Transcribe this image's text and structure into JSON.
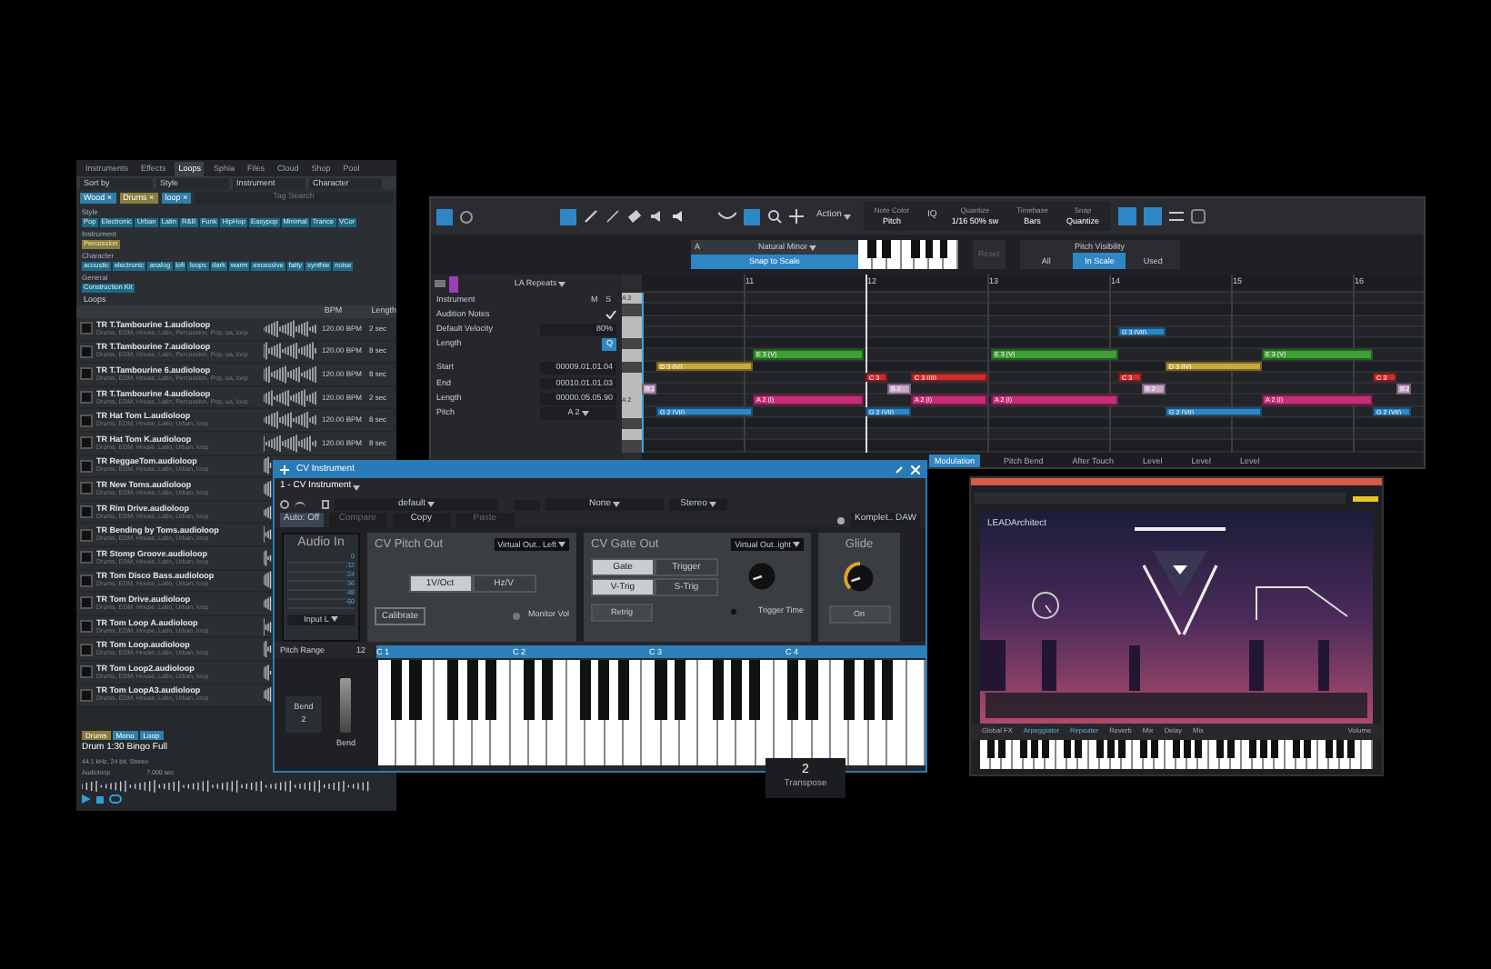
{
  "browser": {
    "tabs": [
      {
        "label": "Instruments",
        "selected": false
      },
      {
        "label": "Effects",
        "selected": false
      },
      {
        "label": "Loops",
        "selected": true
      },
      {
        "label": "Sphia",
        "selected": false
      },
      {
        "label": "Files",
        "selected": false
      },
      {
        "label": "Cloud",
        "selected": false
      },
      {
        "label": "Shop",
        "selected": false
      },
      {
        "label": "Pool",
        "selected": false
      }
    ],
    "filters": [
      "Sort by",
      "Style",
      "Instrument",
      "Character"
    ],
    "active_tags": [
      "Wood ×",
      "Drums ×",
      "loop ×"
    ],
    "search": {
      "placeholder": "Tag Search"
    },
    "tag_groups": [
      {
        "title": "Style",
        "tags": [
          {
            "label": "Pop",
            "selected": false
          },
          {
            "label": "Electronic",
            "selected": false
          },
          {
            "label": "Urban",
            "selected": false
          },
          {
            "label": "Latin",
            "selected": false
          },
          {
            "label": "R&B",
            "selected": false
          },
          {
            "label": "Funk",
            "selected": false
          },
          {
            "label": "HipHop",
            "selected": false
          },
          {
            "label": "Easypop",
            "selected": false
          },
          {
            "label": "Minimal",
            "selected": false
          },
          {
            "label": "Trance",
            "selected": false
          },
          {
            "label": "VCor",
            "selected": false
          }
        ]
      },
      {
        "title": "Instrument",
        "tags": [
          {
            "label": "Percussion",
            "selected": true
          }
        ]
      },
      {
        "title": "Character",
        "tags": [
          {
            "label": "acoustic",
            "selected": false
          },
          {
            "label": "electronic",
            "selected": false
          },
          {
            "label": "analog",
            "selected": false
          },
          {
            "label": "lofi",
            "selected": false
          },
          {
            "label": "loops",
            "selected": false
          },
          {
            "label": "dark",
            "selected": false
          },
          {
            "label": "warm",
            "selected": false
          },
          {
            "label": "excessive",
            "selected": false
          },
          {
            "label": "fatty",
            "selected": false
          },
          {
            "label": "synthie",
            "selected": false
          },
          {
            "label": "noise",
            "selected": false
          }
        ]
      },
      {
        "title": "General",
        "tags": [
          {
            "label": "Construction Kit",
            "selected": false
          }
        ]
      }
    ],
    "list_title": "Loops",
    "columns": [
      "BPM",
      "Length"
    ],
    "loops": [
      {
        "name": "TR T.Tambourine 1.audioloop",
        "tags": "Drums, EDM, House, Latin, Percussion, Pop, ua, loop",
        "bpm": "120.00 BPM",
        "length": "2 sec"
      },
      {
        "name": "TR T.Tambourine 7.audioloop",
        "tags": "Drums, EDM, House, Latin, Percussion, Pop, ua, loop",
        "bpm": "120.00 BPM",
        "length": "8 sec"
      },
      {
        "name": "TR T.Tambourine 6.audioloop",
        "tags": "Drums, EDM, House, Latin, Percussion, Pop, ua, loop",
        "bpm": "120.00 BPM",
        "length": "8 sec"
      },
      {
        "name": "TR T.Tambourine 4.audioloop",
        "tags": "Drums, EDM, House, Latin, Percussion, Pop, ua, loop",
        "bpm": "120.00 BPM",
        "length": "2 sec"
      },
      {
        "name": "TR Hat Tom L.audioloop",
        "tags": "Drums, EDM, House, Latin, Urban, loop",
        "bpm": "120.00 BPM",
        "length": "8 sec"
      },
      {
        "name": "TR Hat Tom K.audioloop",
        "tags": "Drums, EDM, House, Latin, Urban, loop",
        "bpm": "120.00 BPM",
        "length": "8 sec"
      },
      {
        "name": "TR ReggaeTom.audioloop",
        "tags": "Drums, EDM, House, Latin, Urban, loop"
      },
      {
        "name": "TR New Toms.audioloop",
        "tags": "Drums, EDM, House, Latin, Urban, loop"
      },
      {
        "name": "TR Rim Drive.audioloop",
        "tags": "Drums, EDM, House, Latin, Urban, loop"
      },
      {
        "name": "TR Bending by Toms.audioloop",
        "tags": "Drums, EDM, House, Latin, Urban, loop"
      },
      {
        "name": "TR Stomp Groove.audioloop",
        "tags": "Drums, EDM, House, Latin, Urban, loop"
      },
      {
        "name": "TR Tom Disco Bass.audioloop",
        "tags": "Drums, EDM, House, Latin, Urban, loop"
      },
      {
        "name": "TR Tom Drive.audioloop",
        "tags": "Drums, EDM, House, Latin, Urban, loop"
      },
      {
        "name": "TR Tom Loop A.audioloop",
        "tags": "Drums, EDM, House, Latin, Urban, loop"
      },
      {
        "name": "TR Tom Loop.audioloop",
        "tags": "Drums, EDM, House, Latin, Urban, loop"
      },
      {
        "name": "TR Tom Loop2.audioloop",
        "tags": "Drums, EDM, House, Latin, Urban, loop"
      },
      {
        "name": "TR Tom LoopA3.audioloop",
        "tags": "Drums, EDM, House, Latin, Urban, loop"
      }
    ],
    "preview": {
      "tags": [
        {
          "label": "Drums",
          "color": "#8a7d3c"
        },
        {
          "label": "Mono",
          "color": "#2f7fa8"
        },
        {
          "label": "Loop",
          "color": "#2f7fa8"
        }
      ],
      "title": "Drum 1:30 Bingo Full",
      "info": "44.1 kHz, 24 bit, Stereo",
      "type": "Audioloop",
      "duration": "7.000 sec"
    }
  },
  "editor": {
    "toolbar": {
      "action": "Action",
      "fields": [
        {
          "label": "Note Color",
          "value": "Pitch"
        },
        {
          "label": "Quantize",
          "value": "1/16 50% sw"
        },
        {
          "label": "Timebase",
          "value": "Bars"
        },
        {
          "label": "Snap",
          "value": "Quantize"
        }
      ],
      "iq": "IQ"
    },
    "scale": {
      "root": "A",
      "name": "Natural Minor",
      "snap": "Snap to Scale",
      "reset": "Reset"
    },
    "pitch_visibility": {
      "title": "Pitch Visibility",
      "options": [
        {
          "label": "All",
          "selected": false
        },
        {
          "label": "In Scale",
          "selected": true
        },
        {
          "label": "Used",
          "selected": false
        }
      ]
    },
    "track": {
      "name": "LA Repeats",
      "color": "#9b3fb5"
    },
    "inspector": [
      {
        "kind": "ms",
        "label": "Instrument",
        "m": "M",
        "s": "S"
      },
      {
        "kind": "check",
        "label": "Audition Notes",
        "checked": true
      },
      {
        "kind": "value",
        "label": "Default Velocity",
        "value": "80%"
      },
      {
        "kind": "button",
        "label": "Length",
        "value": "Q"
      },
      {
        "kind": "value",
        "label": "Start",
        "value": "00009.01.01.04"
      },
      {
        "kind": "value",
        "label": "End",
        "value": "00010.01.01.03"
      },
      {
        "kind": "value",
        "label": "Length",
        "value": "00000.05.05.90"
      },
      {
        "kind": "dropdown",
        "label": "Pitch",
        "value": "A 2"
      }
    ],
    "key_labels": [
      "A 3",
      "A 2"
    ],
    "bars": [
      "11",
      "12",
      "13",
      "14",
      "15",
      "16"
    ],
    "notes": [
      {
        "label": "G 3 (VII)",
        "color": "#2f86c4"
      },
      {
        "label": "D 3 (IV)",
        "color": "#c9a93a"
      },
      {
        "label": "D 3 (IV)",
        "color": "#c9a93a"
      },
      {
        "label": "E 3 (V)",
        "color": "#3f9e36"
      },
      {
        "label": "E 3 (V)",
        "color": "#3f9e36"
      },
      {
        "label": "E 3 (V)",
        "color": "#3f9e36"
      },
      {
        "label": "C 3",
        "color": "#c8302f"
      },
      {
        "label": "C 3 (III)",
        "color": "#c8302f"
      },
      {
        "label": "C 3",
        "color": "#c8302f"
      },
      {
        "label": "C 3",
        "color": "#c8302f"
      },
      {
        "label": "B 2",
        "color": "#c9a5c9"
      },
      {
        "label": "B 2",
        "color": "#c9a5c9"
      },
      {
        "label": "B 2",
        "color": "#c9a5c9"
      },
      {
        "label": "B 2",
        "color": "#c9a5c9"
      },
      {
        "label": "A 2 (I)",
        "color": "#c72c7a"
      },
      {
        "label": "A 2 (I)",
        "color": "#c72c7a"
      },
      {
        "label": "A 2 (I)",
        "color": "#c72c7a"
      },
      {
        "label": "A 2 (I)",
        "color": "#c72c7a"
      },
      {
        "label": "G 2 (VII)",
        "color": "#2f86c4"
      },
      {
        "label": "G 2 (VII)",
        "color": "#2f86c4"
      },
      {
        "label": "G 2 (VII)",
        "color": "#2f86c4"
      },
      {
        "label": "G 2 (VII)",
        "color": "#2f86c4"
      }
    ],
    "lanes": [
      {
        "label": "Modulation",
        "selected": true
      },
      {
        "label": "Pitch Bend",
        "selected": false
      },
      {
        "label": "After Touch",
        "selected": false
      },
      {
        "label": "Level",
        "selected": false
      },
      {
        "label": "Level",
        "selected": false
      },
      {
        "label": "Level",
        "selected": false
      }
    ]
  },
  "cv": {
    "title": "CV Instrument",
    "instance": "1 - CV Instrument",
    "preset": "default",
    "sidechain": "None",
    "output": "Stereo",
    "auto": "Auto: Off",
    "compare": "Compare",
    "copy": "Copy",
    "paste": "Paste",
    "device": "Komplet.. DAW",
    "audio_in": {
      "title": "Audio In",
      "scale": [
        "0",
        "-12",
        "-24",
        "-36",
        "-48",
        "-60"
      ],
      "input": "Input L"
    },
    "pitch_out": {
      "title": "CV Pitch Out",
      "output": "Virtual Out.. Left",
      "modes": [
        {
          "label": "1V/Oct",
          "selected": true
        },
        {
          "label": "Hz/V",
          "selected": false
        }
      ],
      "calibrate": "Calibrate",
      "monitor": "Monitor Vol"
    },
    "gate_out": {
      "title": "CV Gate Out",
      "output": "Virtual Out..ight",
      "modes": [
        {
          "label": "Gate",
          "selected": true
        },
        {
          "label": "Trigger",
          "selected": false
        }
      ],
      "trig": [
        {
          "label": "V-Trig",
          "selected": true
        },
        {
          "label": "S-Trig",
          "selected": false
        }
      ],
      "retrig": "Retrig",
      "trigger_time": "Trigger Time"
    },
    "glide": {
      "title": "Glide",
      "button": "On"
    },
    "pitch_range": {
      "label": "Pitch Range",
      "value": "12"
    },
    "octaves": [
      "C 1",
      "C 2",
      "C 3",
      "C 4"
    ],
    "bend": {
      "label": "Bend",
      "value": "2",
      "slider_label": "Bend"
    },
    "transpose": {
      "value": "2",
      "label": "Transpose"
    }
  },
  "synth": {
    "logo": "LEADArchitect",
    "footer": [
      "Global FX",
      "Arpeggiator",
      "Repeater",
      "Reverb",
      "Mix",
      "Delay",
      "Mix",
      "Volume"
    ]
  }
}
